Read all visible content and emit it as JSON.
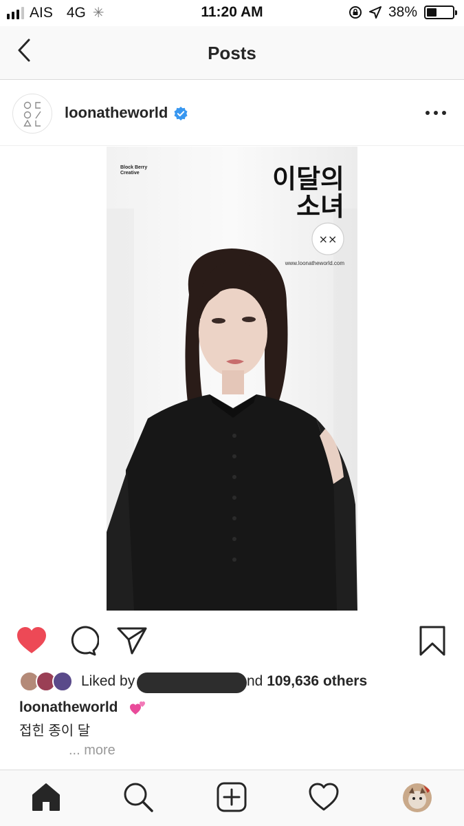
{
  "status_bar": {
    "carrier": "AIS",
    "network": "4G",
    "time": "11:20 AM",
    "battery_percent_label": "38%",
    "battery_level": 0.38,
    "signal_bars_active": 3,
    "signal_bars_total": 4
  },
  "header": {
    "title": "Posts",
    "back_icon": "chevron-left-icon"
  },
  "post": {
    "username": "loonatheworld",
    "verified": true,
    "more_icon": "more-dots-icon",
    "avatar_logo_text": "OC O/ ΔL",
    "image": {
      "brand_text": "Block Berry Creative",
      "title_line1": "이달의",
      "title_line2": "소녀",
      "badge_text": "××",
      "website": "www.loonatheworld.com"
    },
    "actions": {
      "like_icon": "heart-filled-icon",
      "liked": true,
      "comment_icon": "comment-icon",
      "share_icon": "send-icon",
      "save_icon": "bookmark-icon"
    },
    "likes": {
      "prefix": "Liked by",
      "suffix_start": "nd",
      "count": "109,636 others"
    },
    "caption": {
      "username": "loonatheworld",
      "emoji_icon": "two-hearts-icon",
      "text": "접힌 종이 달",
      "more": "... more"
    }
  },
  "tab_bar": {
    "items": [
      "home-icon",
      "search-icon",
      "new-post-icon",
      "activity-heart-icon",
      "profile-avatar"
    ],
    "active": "home-icon"
  },
  "colors": {
    "like_red": "#ed4956",
    "verified_blue": "#3897f0",
    "text": "#262626",
    "muted": "#999999"
  }
}
